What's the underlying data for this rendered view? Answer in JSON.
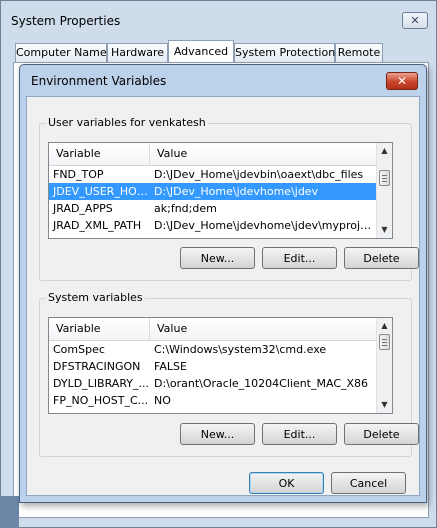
{
  "system_properties": {
    "title": "System Properties",
    "close_glyph": "✕",
    "tabs": [
      "Computer Name",
      "Hardware",
      "Advanced",
      "System Protection",
      "Remote"
    ],
    "active_tab": "Advanced"
  },
  "env_dialog": {
    "title": "Environment Variables",
    "close_glyph": "✕",
    "user_group": {
      "label": "User variables for venkatesh",
      "columns": [
        "Variable",
        "Value"
      ],
      "rows": [
        {
          "variable": "FND_TOP",
          "value": "D:\\JDev_Home\\jdevbin\\oaext\\dbc_files"
        },
        {
          "variable": "JDEV_USER_HOME",
          "value": "D:\\JDev_Home\\jdevhome\\jdev"
        },
        {
          "variable": "JRAD_APPS",
          "value": "ak;fnd;dem"
        },
        {
          "variable": "JRAD_XML_PATH",
          "value": "D:\\JDev_Home\\jdevhome\\jdev\\myproje..."
        }
      ],
      "selected_row": 1,
      "buttons": {
        "new": "New...",
        "edit": "Edit...",
        "delete": "Delete"
      }
    },
    "system_group": {
      "label": "System variables",
      "columns": [
        "Variable",
        "Value"
      ],
      "rows": [
        {
          "variable": "ComSpec",
          "value": "C:\\Windows\\system32\\cmd.exe"
        },
        {
          "variable": "DFSTRACINGON",
          "value": "FALSE"
        },
        {
          "variable": "DYLD_LIBRARY_...",
          "value": "D:\\orant\\Oracle_10204Client_MAC_X86"
        },
        {
          "variable": "FP_NO_HOST_C...",
          "value": "NO"
        }
      ],
      "buttons": {
        "new": "New...",
        "edit": "Edit...",
        "delete": "Delete"
      }
    },
    "ok_label": "OK",
    "cancel_label": "Cancel"
  },
  "colors": {
    "selection": "#3399ff",
    "close_button_red": "#c9452a",
    "dialog_frame": "#bcd1ea"
  }
}
